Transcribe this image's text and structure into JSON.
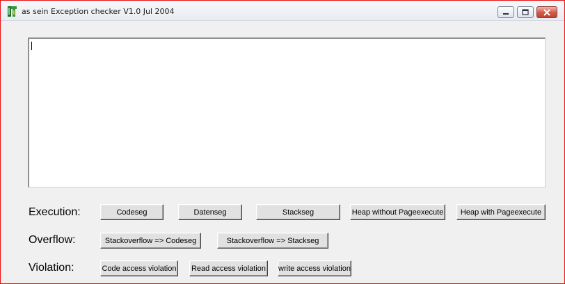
{
  "window": {
    "title": "as sein Exception checker V1.0 Jul 2004",
    "minimize_icon": "minimize-icon",
    "maximize_icon": "maximize-icon",
    "close_icon": "close-icon"
  },
  "output": {
    "value": ""
  },
  "execution": {
    "label": "Execution:",
    "buttons": [
      "Codeseg",
      "Datenseg",
      "Stackseg",
      "Heap without Pageexecute",
      "Heap with Pageexecute"
    ]
  },
  "overflow": {
    "label": "Overflow:",
    "buttons": [
      "Stackoverflow => Codeseg",
      "Stackoverflow => Stackseg"
    ]
  },
  "violation": {
    "label": "Violation:",
    "buttons": [
      "Code access violation",
      "Read access violation",
      "write access violation"
    ]
  },
  "colors": {
    "window_border": "#e81010",
    "close_button": "#cf5a45",
    "background": "#f0f0f0"
  }
}
